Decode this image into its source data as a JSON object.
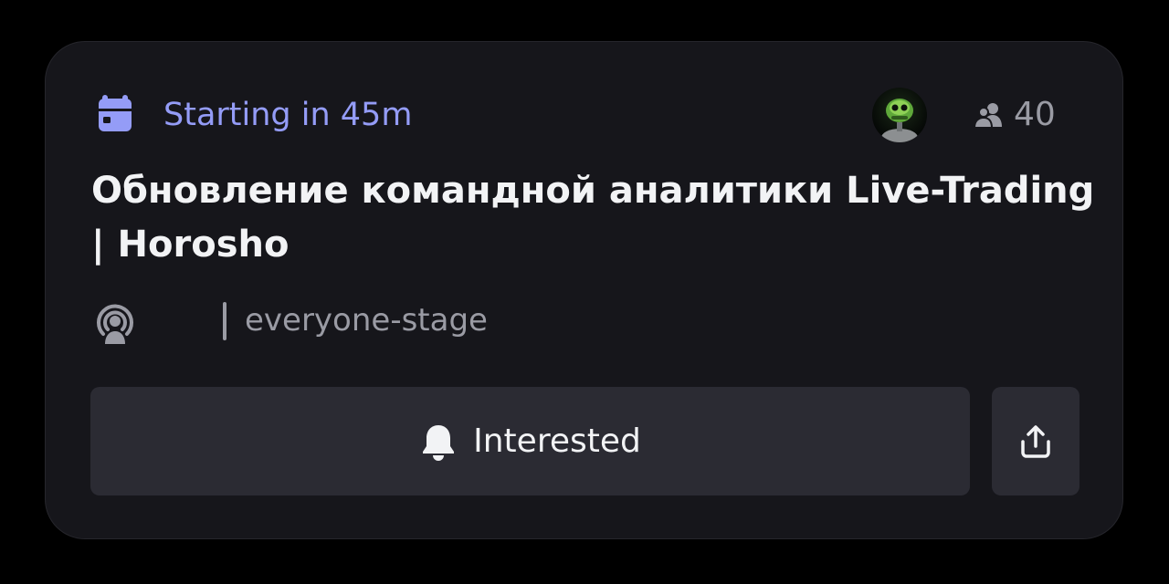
{
  "event": {
    "status_text": "Starting in 45m",
    "attendee_count": "40",
    "title": "Обновление командной аналитики Live-Trading | Horosho",
    "channel_name": "everyone-stage"
  },
  "actions": {
    "interested_label": "Interested"
  },
  "colors": {
    "card_background": "#16161b",
    "accent": "#949cf7",
    "button_background": "#2b2b33",
    "muted_text": "#9a9ba4",
    "title_text": "#f2f3f5"
  },
  "icons": {
    "status": "calendar-icon",
    "attendees": "people-icon",
    "channel": "stage-channel-icon",
    "interested": "bell-icon",
    "share": "share-icon"
  }
}
